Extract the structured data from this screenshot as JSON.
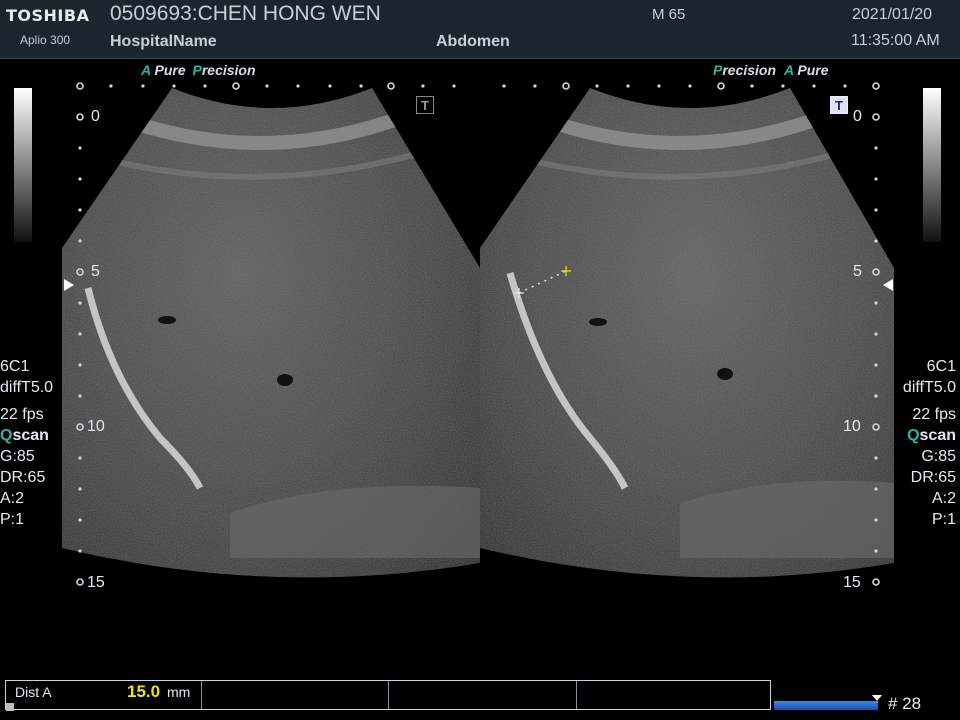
{
  "header": {
    "brand": "TOSHIBA",
    "model": "Aplio 300",
    "patient_id_name": "0509693:CHEN HONG WEN",
    "hospital": "HospitalName",
    "sex_age": "M 65",
    "exam": "Abdomen",
    "date": "2021/01/20",
    "time": "11:35:00 AM"
  },
  "left_panel": {
    "preset_accent_1": "A",
    "preset_word_1": "Pure",
    "preset_accent_2": "P",
    "preset_word_2": "recision",
    "t_marker": "T",
    "depth_labels": [
      "0",
      "5",
      "10",
      "15"
    ]
  },
  "right_panel": {
    "preset_accent_1": "P",
    "preset_word_1": "recision",
    "preset_accent_2": "A",
    "preset_word_2": "Pure",
    "t_marker": "T",
    "depth_labels": [
      "0",
      "5",
      "10",
      "15"
    ]
  },
  "params_left": {
    "probe": "6C1",
    "filter": "diffT5.0",
    "fps": "22 fps",
    "qscan_q": "Q",
    "qscan_rest": "scan",
    "gain": "G:85",
    "dynamic_range": "DR:65",
    "a": "A:2",
    "p": "P:1"
  },
  "params_right": {
    "probe": "6C1",
    "filter": "diffT5.0",
    "fps": "22 fps",
    "qscan_q": "Q",
    "qscan_rest": "scan",
    "gain": "G:85",
    "dynamic_range": "DR:65",
    "a": "A:2",
    "p": "P:1"
  },
  "measurement": {
    "label": "Dist A",
    "value": "15.0",
    "unit": "mm"
  },
  "cine": {
    "frame": "# 28"
  },
  "icons": {
    "t_marker": "body-mark-icon",
    "caliper": "caliper-cross-icon",
    "focus": "focus-triangle-icon"
  },
  "colors": {
    "accent": "#2bb3a8",
    "measure_value": "#f2e600",
    "header_bg": "#1c2430",
    "cine_bar": "#2a6fd0"
  }
}
